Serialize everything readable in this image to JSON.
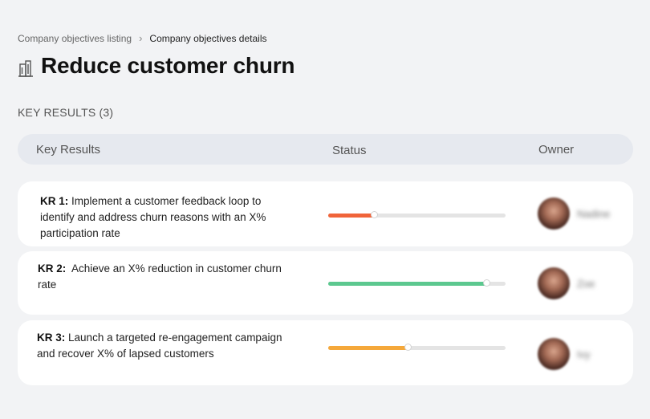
{
  "breadcrumb": {
    "parent": "Company objectives listing",
    "separator": "›",
    "current": "Company objectives details"
  },
  "objective": {
    "icon": "building-icon",
    "title": "Reduce customer churn"
  },
  "key_results_label": "KEY RESULTS (3)",
  "table": {
    "headers": {
      "key_results": "Key Results",
      "status": "Status",
      "owner": "Owner"
    }
  },
  "rows": [
    {
      "label": "KR 1:",
      "text": "Implement a customer feedback loop to identify and address churn reasons with an X% participation rate",
      "progress": 0.26,
      "color": "#f0643a",
      "owner": "Nadine"
    },
    {
      "label": "KR 2:",
      "text": "Achieve an X% reduction in customer churn rate",
      "progress": 0.89,
      "color": "#5cc88f",
      "owner": "Zoe"
    },
    {
      "label": "KR 3:",
      "text": "Launch a targeted re-engagement campaign and recover X% of lapsed customers",
      "progress": 0.45,
      "color": "#f5a83a",
      "owner": "Ivy"
    }
  ]
}
